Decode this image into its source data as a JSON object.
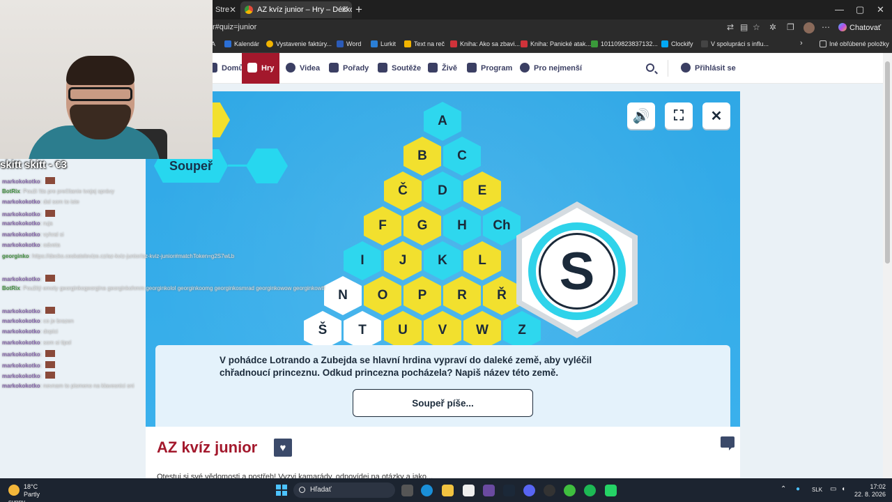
{
  "browser": {
    "tabs": [
      {
        "label": "Stre",
        "active": false
      },
      {
        "label": "AZ kvíz junior – Hry – Déčko",
        "active": true
      }
    ],
    "new_tab": "+",
    "window_controls": [
      "—",
      "▢",
      "✕"
    ],
    "url": "r#quiz=junior",
    "chat_button": "Chatovať",
    "bookmarks": [
      {
        "label": "A",
        "color": "#e24a3a"
      },
      {
        "label": "Kalendár",
        "color": "#2b6fd6"
      },
      {
        "label": "Vystavenie faktúry...",
        "color": "#f2b400"
      },
      {
        "label": "Word",
        "color": "#2b5bb8"
      },
      {
        "label": "Lurkit",
        "color": "#2b7fd6"
      },
      {
        "label": "Text na reč",
        "color": "#f2b400"
      },
      {
        "label": "Kniha: Ako sa zbavi...",
        "color": "#d0333a"
      },
      {
        "label": "Kniha: Panické atak...",
        "color": "#d0333a"
      },
      {
        "label": "101109823837132...",
        "color": "#3a9a3a"
      },
      {
        "label": "Clockify",
        "color": "#03a9f4"
      },
      {
        "label": "V spolupráci s influ...",
        "color": "#444"
      },
      {
        "label": "Iné obľúbené položky",
        "color": "#888"
      }
    ]
  },
  "site_nav": {
    "items": [
      "Domů",
      "Hry",
      "Videa",
      "Pořady",
      "Soutěže",
      "Živě",
      "Program",
      "Pro nejmenší"
    ],
    "login": "Přihlásit se"
  },
  "game": {
    "opponent_label": "Soupeř",
    "hex_letters": {
      "A": "c",
      "B": "y",
      "C": "c",
      "Č": "y",
      "D": "c",
      "E": "y",
      "F": "y",
      "G": "y",
      "H": "c",
      "Ch": "c",
      "I": "c",
      "J": "y",
      "K": "c",
      "L": "y",
      "N": "w",
      "O": "y",
      "P": "y",
      "R": "y",
      "Ř": "y",
      "Š": "w",
      "T": "w",
      "U": "y",
      "V": "y",
      "W": "y",
      "Z": "c"
    },
    "current_letter": "S",
    "buttons": {
      "sound": "🔊",
      "fullscreen": "⛶",
      "close": "✕"
    },
    "question": "V pohádce Lotrando a Zubejda se hlavní hrdina vypraví do daleké země, aby vyléčil chřadnoucí princeznu. Odkud princezna pocházela? Napiš název této země.",
    "answer_status": "Soupeř píše..."
  },
  "page": {
    "title": "AZ kvíz junior",
    "description": "Otestuj si své vědomosti a postřeh! Vyzvi kamarády, odpovídej na otázky a jako..."
  },
  "stream_overlay": {
    "chat_title": "skitt skitt  - €3",
    "messages": [
      {
        "user": "markokokotko",
        "text": "",
        "emote": true
      },
      {
        "user": "BotRix",
        "text": "Použi !tts pre prečítanie tvojej správy",
        "bot": true
      },
      {
        "user": "markokokotko",
        "text": "dal som to iste"
      },
      {
        "user": "markokokotko",
        "text": "",
        "emote": true
      },
      {
        "user": "markokokotko",
        "text": "ruja"
      },
      {
        "user": "markokokotko",
        "text": "vyhral si"
      },
      {
        "user": "markokokotko",
        "text": "odveta"
      },
      {
        "user": "georginko",
        "text": "https://decko.ceskatelevize.cz/az-kviz-junior/az-kviz-junior#matchToken=g2S7wLb",
        "bot": true
      },
      {
        "user": "markokokotko",
        "text": "",
        "emote": true
      },
      {
        "user": "BotRix",
        "text": "Použitý emoty georginkogeorgina georginkohmm georginkolol georginkoomg georginkosmrad georginkowow georginkowtf",
        "bot": true
      },
      {
        "user": "markokokotko",
        "text": "",
        "emote": true
      },
      {
        "user": "markokokotko",
        "text": "co je brazen"
      },
      {
        "user": "markokokotko",
        "text": "dopici"
      },
      {
        "user": "markokokotko",
        "text": "som si tipol"
      },
      {
        "user": "markokokotko",
        "text": "",
        "emote": true
      },
      {
        "user": "markokokotko",
        "text": "",
        "emote": true
      },
      {
        "user": "markokokotko",
        "text": "",
        "emote": true
      },
      {
        "user": "markokokotko",
        "text": "nevnam to pismeno na klavesnici sni"
      }
    ]
  },
  "taskbar": {
    "weather_temp": "18°C",
    "weather_desc": "Partly sunny",
    "search_placeholder": "Hľadať",
    "language": "SLK",
    "time": "17:02",
    "date": "22. 8. 2026"
  }
}
